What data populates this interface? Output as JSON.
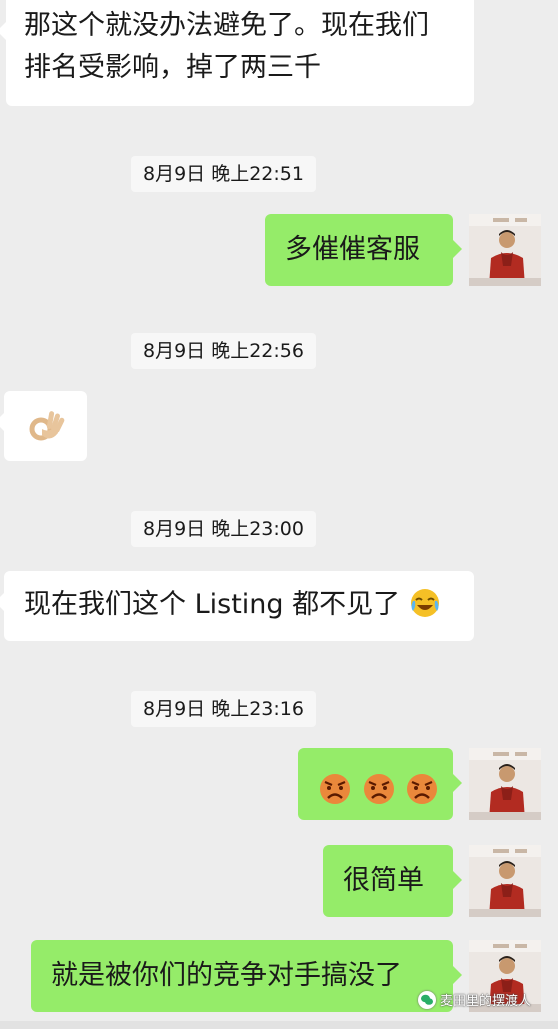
{
  "messages": [
    {
      "side": "left",
      "lines": [
        "那这个就没办法避免了。现在我们",
        "排名受影响，掉了两三千"
      ]
    },
    {
      "side": "right",
      "text": "多催催客服"
    },
    {
      "side": "left",
      "emoji": "ok-hand"
    },
    {
      "side": "left",
      "text": "现在我们这个 Listing 都不见了"
    },
    {
      "side": "right",
      "emoji": "angry-faces"
    },
    {
      "side": "right",
      "text": "很简单"
    },
    {
      "side": "right",
      "text": "就是被你们的竞争对手搞没了"
    }
  ],
  "timestamps": [
    "8月9日 晚上22:51",
    "8月9日 晚上22:56",
    "8月9日 晚上23:00",
    "8月9日 晚上23:16"
  ],
  "watermark": "麦田里的摆渡人",
  "colors": {
    "background": "#ededed",
    "right_bubble": "#95ec69",
    "left_bubble": "#ffffff",
    "timestamp_bg": "#f7f7f7"
  },
  "icons": [
    "ok-hand-emoji",
    "angry-face-emoji",
    "crying-laughing-emoji",
    "user-avatar-icon",
    "wechat-logo-icon"
  ]
}
